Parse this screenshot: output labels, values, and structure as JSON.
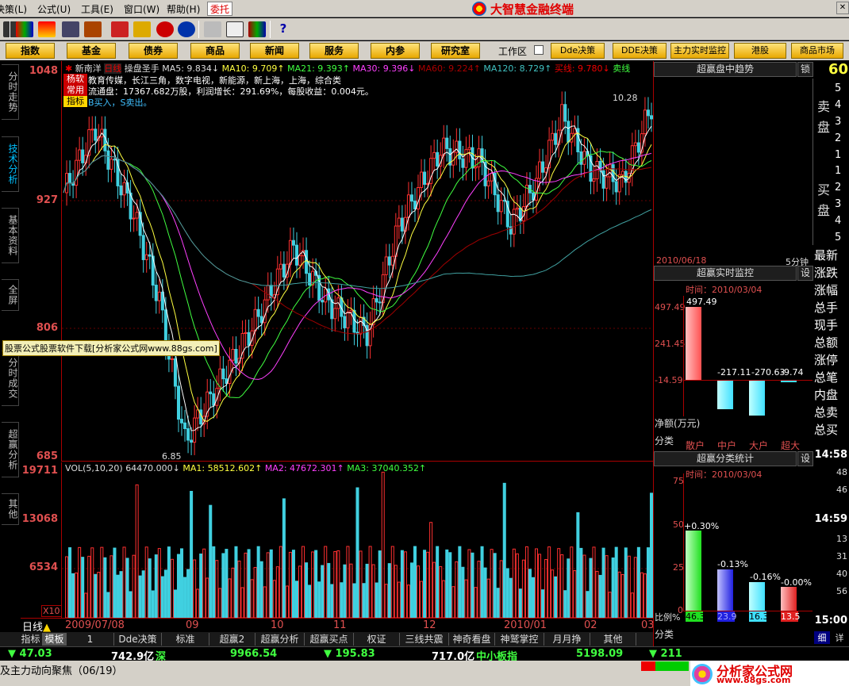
{
  "menu": {
    "items": [
      "决策(L)",
      "公式(U)",
      "工具(E)",
      "窗口(W)",
      "帮助(H)"
    ],
    "entrust": "委托",
    "brand": "大智慧金融终端"
  },
  "nav": {
    "buttons": [
      "指数",
      "基金",
      "债券",
      "商品",
      "新闻",
      "服务",
      "内参",
      "研究室"
    ],
    "workspace": "工作区",
    "right_buttons": [
      "Dde决策",
      "DDE决策",
      "主力实时监控",
      "港股",
      "商品市场"
    ]
  },
  "left_tabs": [
    "分时走势",
    "技术分析",
    "基本资料",
    "全屏",
    "分时成交",
    "超赢分析",
    "其他"
  ],
  "chart": {
    "stock_name": "新南洋",
    "period": "日线",
    "indicator": "操盘圣手",
    "ma_line": [
      "MA5: 9.834↓",
      "MA10: 9.709↑",
      "MA21: 9.393↑",
      "MA30: 9.396↓",
      "MA60: 9.224↑",
      "MA120: 8.729↑",
      "买线: 9.780↓",
      "卖线"
    ],
    "info_line1": "教育传媒，长江三角，数字电视，新能源，新上海，上海，综合类",
    "info_line2": "流通盘：17367.682万股，利润增长：291.69%，每股收益：0.004元。",
    "info_line3": "B买入，S卖出。",
    "tags": [
      "杨软",
      "常用",
      "指标"
    ],
    "price_ticks": [
      "1048",
      "927",
      "806",
      "685"
    ],
    "high_label": "10.28",
    "low_label": "6.85",
    "watermark": "股票公式股票软件下载[分析家公式网www.88gs.com]",
    "vol_line": [
      "VOL(5,10,20)",
      "64470.000↓",
      "MA1: 58512.602↑",
      "MA2: 47672.301↑",
      "MA3: 37040.352↑"
    ],
    "vol_ticks": [
      "19711",
      "13068",
      "6534"
    ],
    "vol_unit": "X10",
    "dates": [
      "2009/07/08",
      "09",
      "10",
      "11",
      "12",
      "2010/01",
      "02",
      "03"
    ],
    "period_label": "日线",
    "bottom_tabs": [
      "指标",
      "模板",
      "1",
      "Dde决策",
      "标准",
      "超赢2",
      "超赢分析",
      "超赢买点",
      "权证",
      "三线共震",
      "神奇看盘",
      "神鹫掌控",
      "月月挣",
      "其他"
    ]
  },
  "chart_data": [
    {
      "type": "candlestick",
      "title": "新南洋 日线",
      "ylim": [
        6.85,
        10.48
      ],
      "series": [
        {
          "name": "MA5",
          "last": 9.834
        },
        {
          "name": "MA10",
          "last": 9.709
        },
        {
          "name": "MA21",
          "last": 9.393
        },
        {
          "name": "MA30",
          "last": 9.396
        },
        {
          "name": "MA60",
          "last": 9.224
        },
        {
          "name": "MA120",
          "last": 8.729
        }
      ],
      "annotations": [
        "10.28",
        "6.85"
      ]
    },
    {
      "type": "bar",
      "title": "VOL(5,10,20)",
      "ylim": [
        0,
        19711
      ],
      "series": [
        {
          "name": "MA1",
          "last": 58512.602
        },
        {
          "name": "MA2",
          "last": 47672.301
        },
        {
          "name": "MA3",
          "last": 37040.352
        }
      ]
    }
  ],
  "trend_panel": {
    "title": "超赢盘中趋势",
    "lock": "锁",
    "top_value": "60",
    "sell_label": "卖盘",
    "sell_nums": [
      "5",
      "4",
      "3",
      "2",
      "1"
    ],
    "buy_label": "买盘",
    "buy_nums": [
      "1",
      "2",
      "3",
      "4",
      "5"
    ],
    "date": "2010/06/18",
    "period": "5分钟"
  },
  "monitor_panel": {
    "title": "超赢实时监控",
    "btn": "设",
    "time": "时间：2010/03/04",
    "axis": [
      "497.49",
      "241.45",
      "-14.59"
    ],
    "bar_values": [
      "497.49",
      "-217.11",
      "-270.63",
      "-9.74"
    ],
    "net_label": "净额(万元)",
    "category_label": "分类",
    "categories": [
      "散户",
      "中户",
      "大户",
      "超大"
    ],
    "side_labels": [
      "最新",
      "涨跌",
      "涨幅",
      "总手",
      "现手",
      "总额",
      "涨停",
      "总笔",
      "内盘",
      "总卖",
      "总买"
    ]
  },
  "class_panel": {
    "title": "超赢分类统计",
    "btn": "设",
    "time": "时间：2010/03/04",
    "axis": [
      "75",
      "50",
      "25",
      "0"
    ],
    "bar_labels": [
      "+0.30%",
      "-0.13%",
      "-0.16%",
      "-0.00%"
    ],
    "ratio_label": "比例%",
    "ratios": [
      "46.3",
      "23.9",
      "16.3",
      "13.5"
    ],
    "category_label": "分类",
    "categories": [
      "散户",
      "中户",
      "大户",
      "超大"
    ],
    "times": [
      "14:58",
      "48",
      "46",
      "14:59",
      "13",
      "31",
      "40",
      "56",
      "15:00"
    ],
    "footer": [
      "细",
      "详"
    ]
  },
  "status": {
    "items": [
      "▼ 47.03",
      "742.9亿",
      "深",
      "9966.54",
      "▼ 195.83",
      "717.0亿",
      "中小板指",
      "5198.09",
      "▼ 211"
    ],
    "ticker": "及主力动向聚焦（06/19）",
    "logo_text": "分析家公式网",
    "logo_url": "www.88gs.com"
  }
}
